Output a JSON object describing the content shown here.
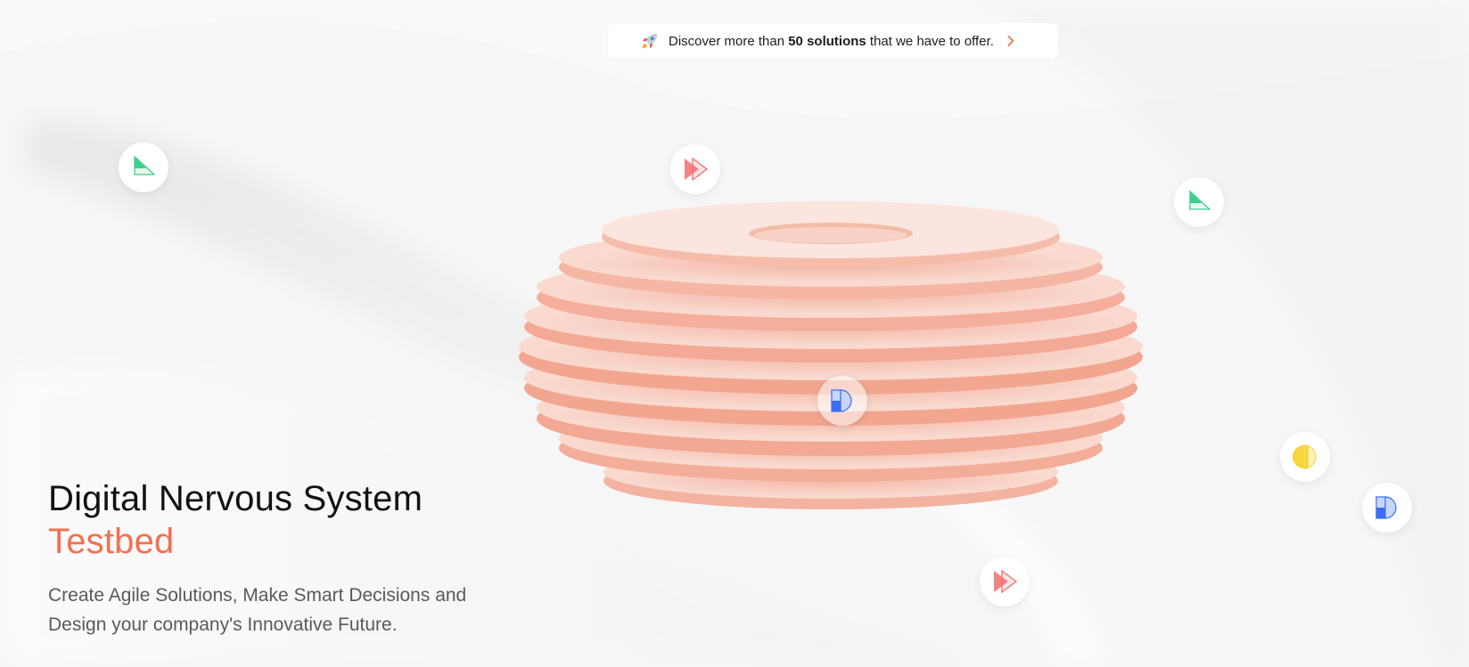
{
  "announcement": {
    "icon": "rocket-icon",
    "text_before": "Discover more than ",
    "text_bold": "50 solutions",
    "text_after": " that we have to offer.",
    "arrow_icon": "chevron-right-icon"
  },
  "hero": {
    "title_line1": "Digital Nervous System",
    "title_line2": "Testbed",
    "subtitle_line1": "Create Agile Solutions, Make Smart Decisions and",
    "subtitle_line2": "Design your company's Innovative Future."
  },
  "floating_badges": [
    {
      "icon": "triangle-icon",
      "color": "#3ecf8e"
    },
    {
      "icon": "play-forward-icon",
      "color": "#f26d6d"
    },
    {
      "icon": "triangle-icon",
      "color": "#3ecf8e"
    },
    {
      "icon": "half-circle-square-icon",
      "color": "#3b6ef5"
    },
    {
      "icon": "double-half-circle-icon",
      "color": "#f7d53b"
    },
    {
      "icon": "half-circle-square-icon",
      "color": "#3b6ef5"
    },
    {
      "icon": "play-forward-icon",
      "color": "#f26d6d"
    }
  ],
  "colors": {
    "accent": "#f2704f",
    "background": "#f7f7f7",
    "disc": "#f6b6a3"
  }
}
